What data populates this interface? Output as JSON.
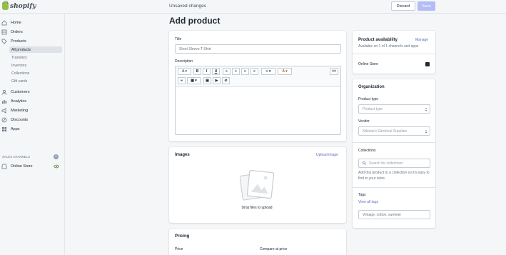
{
  "app": {
    "brand": "shopify"
  },
  "topbar": {
    "status": "Unsaved changes",
    "discard_label": "Discard",
    "save_label": "Save"
  },
  "sidebar": {
    "items": [
      {
        "label": "Home",
        "icon": "home-icon"
      },
      {
        "label": "Orders",
        "icon": "orders-icon"
      },
      {
        "label": "Products",
        "icon": "tag-icon"
      },
      {
        "label": "Customers",
        "icon": "customers-icon"
      },
      {
        "label": "Analytics",
        "icon": "analytics-icon"
      },
      {
        "label": "Marketing",
        "icon": "megaphone-icon"
      },
      {
        "label": "Discounts",
        "icon": "discount-icon"
      },
      {
        "label": "Apps",
        "icon": "apps-icon"
      }
    ],
    "product_subitems": [
      "All products",
      "Transfers",
      "Inventory",
      "Collections",
      "Gift cards"
    ],
    "sales_channels_header": "SALES CHANNELS",
    "online_store_label": "Online Store"
  },
  "page": {
    "title": "Add product"
  },
  "product_form": {
    "title_label": "Title",
    "title_placeholder": "Short Sleeve T-Shirt",
    "description_label": "Description"
  },
  "images": {
    "heading": "Images",
    "upload_link": "Upload image",
    "drop_text": "Drop files to upload"
  },
  "pricing": {
    "heading": "Pricing",
    "price_label": "Price",
    "compare_label": "Compare at price"
  },
  "availability": {
    "heading": "Product availability",
    "manage_link": "Manage",
    "subtitle": "Available on 1 of 1 channels and apps",
    "channel": "Online Store"
  },
  "organization": {
    "heading": "Organization",
    "product_type_label": "Product type",
    "product_type_placeholder": "Product type",
    "vendor_label": "Vendor",
    "vendor_value": "Nikolas's Electrical Supplies",
    "collections_label": "Collections",
    "collections_placeholder": "Search for collections",
    "collections_help": "Add this product to a collection so it's easy to find in your store.",
    "tags_label": "Tags",
    "view_all_tags": "View all tags",
    "tags_placeholder": "Vintage, cotton, summer"
  },
  "colors": {
    "accent": "#5c6ac4",
    "save_disabled": "#b3bcf5",
    "brand_green": "#95bf47"
  }
}
